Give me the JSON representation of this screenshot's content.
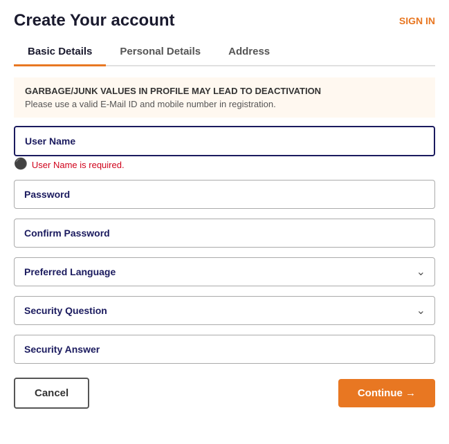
{
  "header": {
    "title": "Create Your account",
    "sign_in_label": "SIGN IN"
  },
  "tabs": [
    {
      "id": "basic-details",
      "label": "Basic Details",
      "active": true
    },
    {
      "id": "personal-details",
      "label": "Personal Details",
      "active": false
    },
    {
      "id": "address",
      "label": "Address",
      "active": false
    }
  ],
  "warning": {
    "title": "GARBAGE/JUNK VALUES IN PROFILE MAY LEAD TO DEACTIVATION",
    "subtitle": "Please use a valid E-Mail ID and mobile number in registration."
  },
  "form": {
    "username": {
      "placeholder": "User Name",
      "value": ""
    },
    "username_error": "User Name is required.",
    "password": {
      "placeholder": "Password",
      "value": ""
    },
    "confirm_password": {
      "placeholder": "Confirm Password",
      "value": ""
    },
    "preferred_language": {
      "placeholder": "Preferred Language",
      "value": ""
    },
    "security_question": {
      "placeholder": "Security Question",
      "value": ""
    },
    "security_answer": {
      "placeholder": "Security Answer",
      "value": ""
    }
  },
  "buttons": {
    "cancel_label": "Cancel",
    "continue_label": "Continue →"
  },
  "colors": {
    "accent": "#e87722",
    "error": "#d0021b",
    "active_tab_border": "#e87722",
    "field_label": "#1a1a5e"
  }
}
